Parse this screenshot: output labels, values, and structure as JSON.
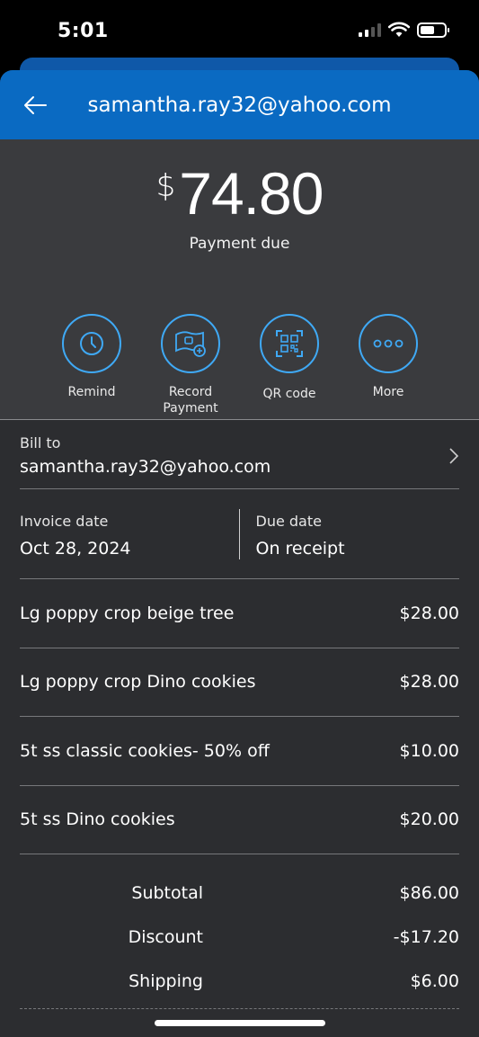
{
  "status_bar": {
    "time": "5:01"
  },
  "header": {
    "title": "samantha.ray32@yahoo.com"
  },
  "amount": {
    "currency_symbol": "$",
    "value": "74.80",
    "label": "Payment due"
  },
  "actions": [
    {
      "label": "Remind",
      "icon": "clock-icon"
    },
    {
      "label": "Record Payment",
      "icon": "record-payment-icon"
    },
    {
      "label": "QR code",
      "icon": "qr-code-icon"
    },
    {
      "label": "More",
      "icon": "more-dots-icon"
    }
  ],
  "bill_to": {
    "label": "Bill to",
    "email": "samantha.ray32@yahoo.com"
  },
  "dates": {
    "invoice_label": "Invoice date",
    "invoice_value": "Oct 28, 2024",
    "due_label": "Due date",
    "due_value": "On receipt"
  },
  "items": [
    {
      "name": "Lg poppy crop beige tree",
      "price": "$28.00"
    },
    {
      "name": "Lg poppy crop Dino cookies",
      "price": "$28.00"
    },
    {
      "name": "5t ss classic cookies- 50% off",
      "price": "$10.00"
    },
    {
      "name": "5t ss Dino cookies",
      "price": "$20.00"
    }
  ],
  "totals": [
    {
      "label": "Subtotal",
      "value": "$86.00"
    },
    {
      "label": "Discount",
      "value": "-$17.20"
    },
    {
      "label": "Shipping",
      "value": "$6.00"
    }
  ],
  "colors": {
    "header_blue": "#0a6ac2",
    "accent_blue": "#3fa9f5",
    "panel": "#3a3b3e",
    "content": "#2c2d30"
  }
}
